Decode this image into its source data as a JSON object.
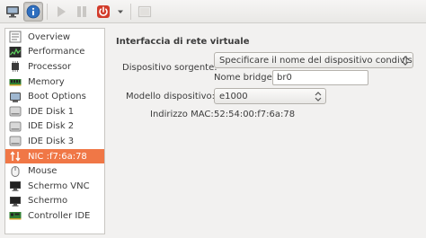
{
  "toolbar": {
    "buttons": [
      {
        "name": "console-button",
        "icon": "monitor-icon"
      },
      {
        "name": "details-button",
        "icon": "info-icon",
        "active": true
      },
      {
        "name": "run-button",
        "icon": "play-icon"
      },
      {
        "name": "pause-button",
        "icon": "pause-icon"
      },
      {
        "name": "shutdown-button",
        "icon": "power-icon"
      },
      {
        "name": "shutdown-menu-button",
        "icon": "chevron-down-icon"
      },
      {
        "name": "fullscreen-button",
        "icon": "fullscreen-icon"
      }
    ]
  },
  "sidebar": {
    "items": [
      {
        "label": "Overview",
        "icon": "overview-icon"
      },
      {
        "label": "Performance",
        "icon": "performance-icon"
      },
      {
        "label": "Processor",
        "icon": "processor-icon"
      },
      {
        "label": "Memory",
        "icon": "memory-icon"
      },
      {
        "label": "Boot Options",
        "icon": "boot-options-icon"
      },
      {
        "label": "IDE Disk 1",
        "icon": "disk-icon"
      },
      {
        "label": "IDE Disk 2",
        "icon": "disk-icon"
      },
      {
        "label": "IDE Disk 3",
        "icon": "disk-icon"
      },
      {
        "label": "NIC :f7:6a:78",
        "icon": "network-icon",
        "selected": true
      },
      {
        "label": "Mouse",
        "icon": "mouse-icon"
      },
      {
        "label": "Schermo VNC",
        "icon": "display-icon"
      },
      {
        "label": "Schermo",
        "icon": "display-icon"
      },
      {
        "label": "Controller IDE",
        "icon": "controller-icon"
      }
    ],
    "selected_color": "#f07746"
  },
  "details": {
    "section_title": "Interfaccia di rete virtuale",
    "source_device_label": "Dispositivo sorgente:",
    "source_device_value": "Specificare il nome del dispositivo condiviso",
    "bridge_name_label": "Nome bridge:",
    "bridge_name_value": "br0",
    "device_model_label": "Modello dispositivo:",
    "device_model_value": "e1000",
    "mac_address_label": "Indirizzo MAC:",
    "mac_address_value": "52:54:00:f7:6a:78"
  }
}
